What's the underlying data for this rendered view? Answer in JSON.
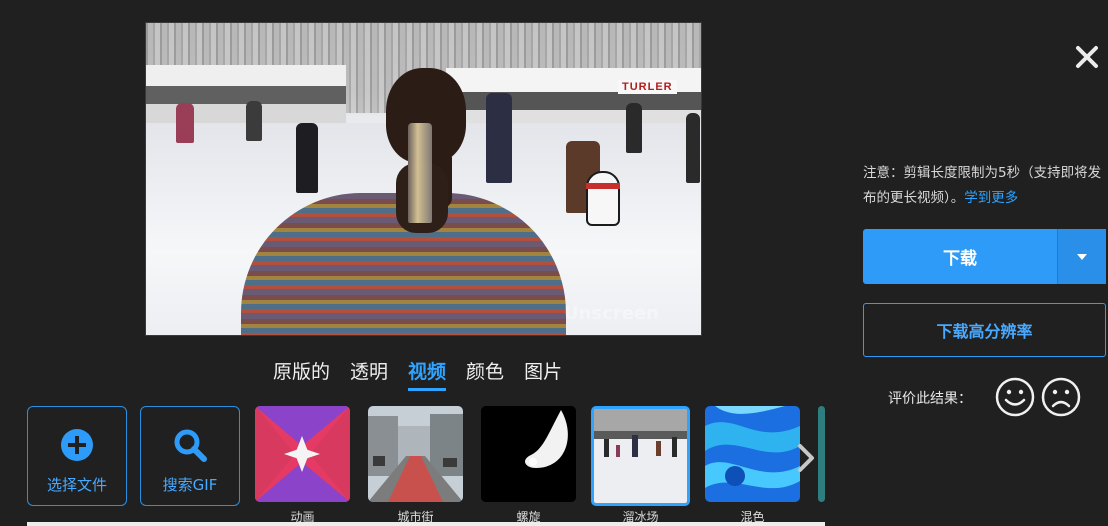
{
  "preview": {
    "sign_text": "TURLER",
    "watermark": "Unscreen"
  },
  "tabs": [
    {
      "label": "原版的",
      "active": false
    },
    {
      "label": "透明",
      "active": false
    },
    {
      "label": "视频",
      "active": true
    },
    {
      "label": "颜色",
      "active": false
    },
    {
      "label": "图片",
      "active": false
    }
  ],
  "actions": {
    "choose_file": "选择文件",
    "search_gif": "搜索GIF"
  },
  "thumbnails": [
    {
      "label": "动画",
      "selected": false
    },
    {
      "label": "城市街",
      "selected": false
    },
    {
      "label": "螺旋",
      "selected": false
    },
    {
      "label": "溜冰场",
      "selected": true
    },
    {
      "label": "混色",
      "selected": false
    }
  ],
  "panel": {
    "note": "注意：剪辑长度限制为5秒（支持即将发布的更长视频）。",
    "learn_more": "学到更多",
    "download": "下载",
    "download_hd": "下载高分辨率",
    "rate_label": "评价此结果："
  },
  "colors": {
    "accent": "#2e9bf8",
    "background": "#202020"
  }
}
